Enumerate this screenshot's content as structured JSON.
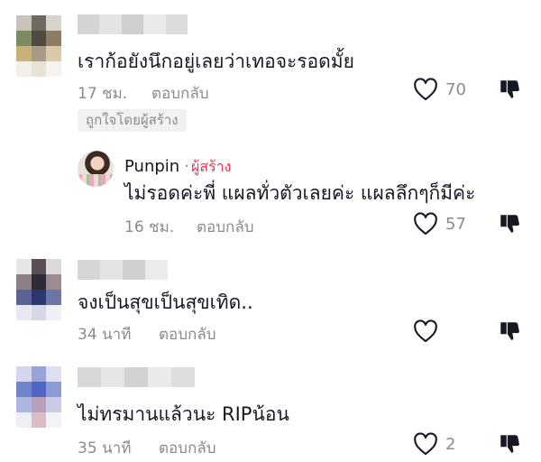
{
  "comments": [
    {
      "text": "เราก้อยังนึกอยู่เลยว่าเทอจะรอดมั้ย",
      "time": "17 ชม.",
      "reply_label": "ตอบกลับ",
      "likes": "70",
      "badge": "ถูกใจโดยผู้สร้าง"
    },
    {
      "text": "จงเป็นสุขเป็นสุขเทิด..",
      "time": "34 นาที",
      "reply_label": "ตอบกลับ",
      "likes": ""
    },
    {
      "text": "ไม่ทรมานแล้วนะ RIPน้อน",
      "time": "35 นาที",
      "reply_label": "ตอบกลับ",
      "likes": "2"
    }
  ],
  "reply": {
    "author": "Punpin",
    "separator": "·",
    "author_badge": "ผู้สร้าง",
    "text": "ไม่รอดค่ะพี่ แผลทั่วตัวเลยค่ะ แผลลึกๆก็มีค่ะ",
    "time": "16 ชม.",
    "reply_label": "ตอบกลับ",
    "likes": "57"
  },
  "icons": {
    "like": "heart-outline-icon",
    "dislike": "thumbs-down-icon",
    "brand_accent": "#fe2c55",
    "muted": "#8a8b91"
  }
}
